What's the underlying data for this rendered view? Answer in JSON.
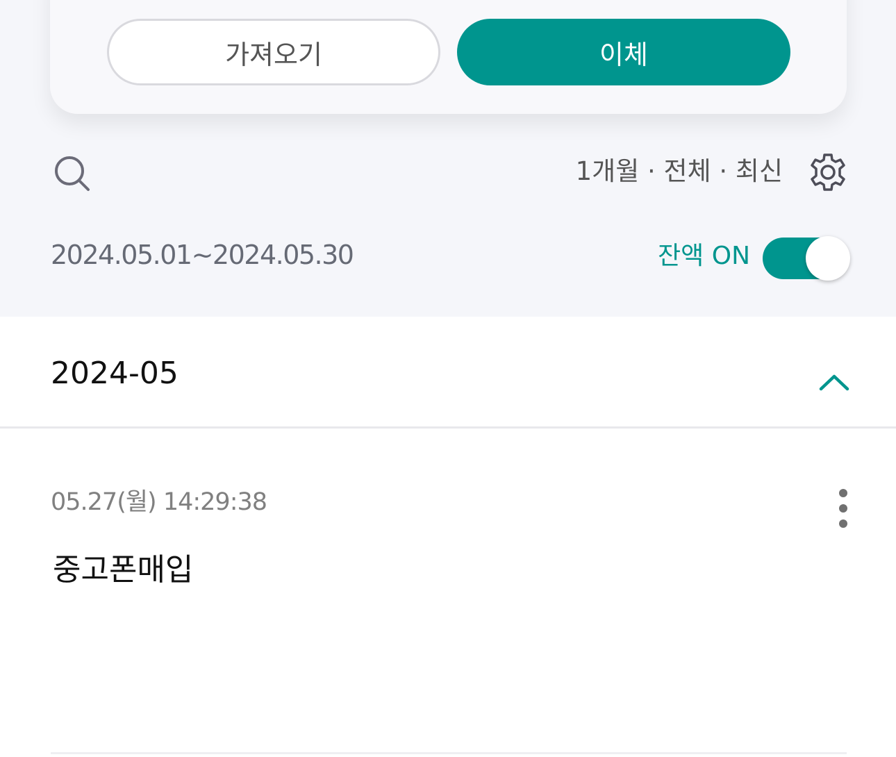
{
  "actions": {
    "import_label": "가져오기",
    "transfer_label": "이체"
  },
  "filters": {
    "summary": "1개월 · 전체 · 최신"
  },
  "period": {
    "range": "2024.05.01~2024.05.30",
    "balance_label": "잔액 ON",
    "balance_toggle_on": true
  },
  "group": {
    "month": "2024-05",
    "expanded": true
  },
  "transaction": {
    "datetime": "05.27(월) 14:29:38",
    "name": "중고폰매입"
  },
  "colors": {
    "accent": "#00958e",
    "background": "#f5f6fa"
  },
  "icons": {
    "search": "search-icon",
    "settings": "gear-icon",
    "collapse": "chevron-up-icon",
    "more": "more-vertical-icon"
  }
}
